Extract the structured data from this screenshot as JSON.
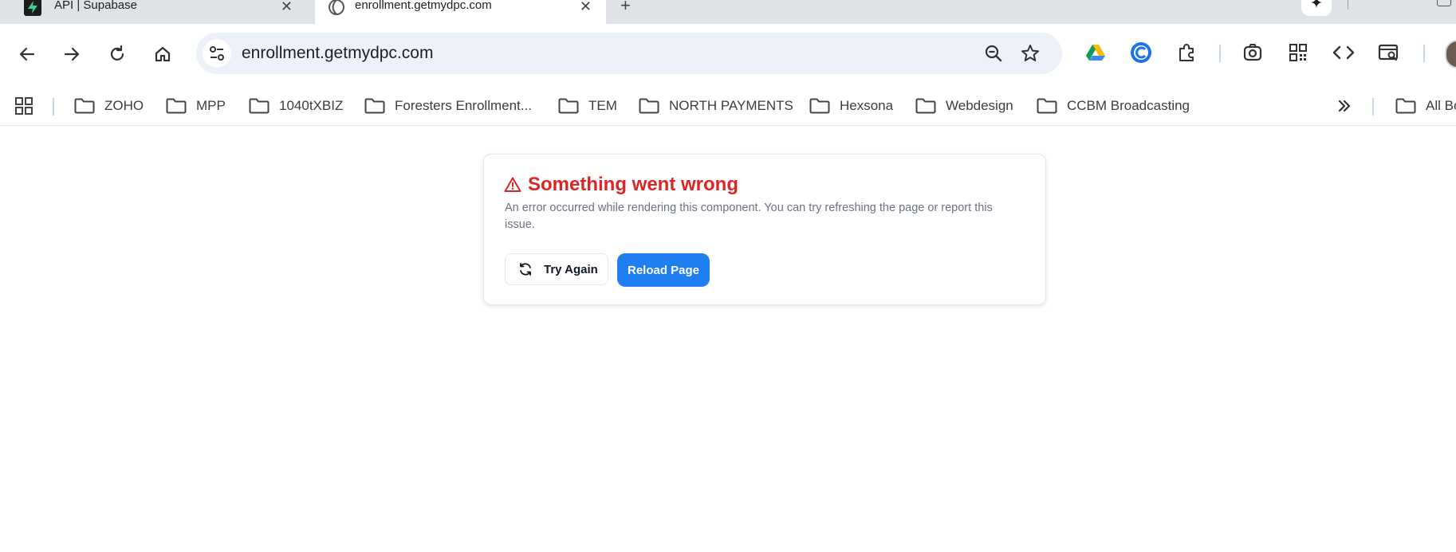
{
  "tabs": [
    {
      "title": "API | Supabase",
      "active": false
    },
    {
      "title": "enrollment.getmydpc.com",
      "active": true
    }
  ],
  "new_tab_label": "+",
  "omnibox": {
    "url": "enrollment.getmydpc.com"
  },
  "bookmarks": {
    "items": [
      "ZOHO",
      "MPP",
      "1040tXBIZ",
      "Foresters Enrollment...",
      "TEM",
      "NORTH PAYMENTS",
      "Hexsona",
      "Webdesign",
      "CCBM Broadcasting"
    ],
    "all_bookmarks_label": "All Bookmarks"
  },
  "error_card": {
    "title": "Something went wrong",
    "message": "An error occurred while rendering this component. You can try refreshing the page or report this issue.",
    "try_again_label": "Try Again",
    "reload_label": "Reload Page"
  },
  "colors": {
    "error_red": "#dc2626",
    "primary_blue": "#1f7ff0",
    "omnibox_bg": "#edf1f9",
    "tabstrip_bg": "#dfe3e8"
  }
}
